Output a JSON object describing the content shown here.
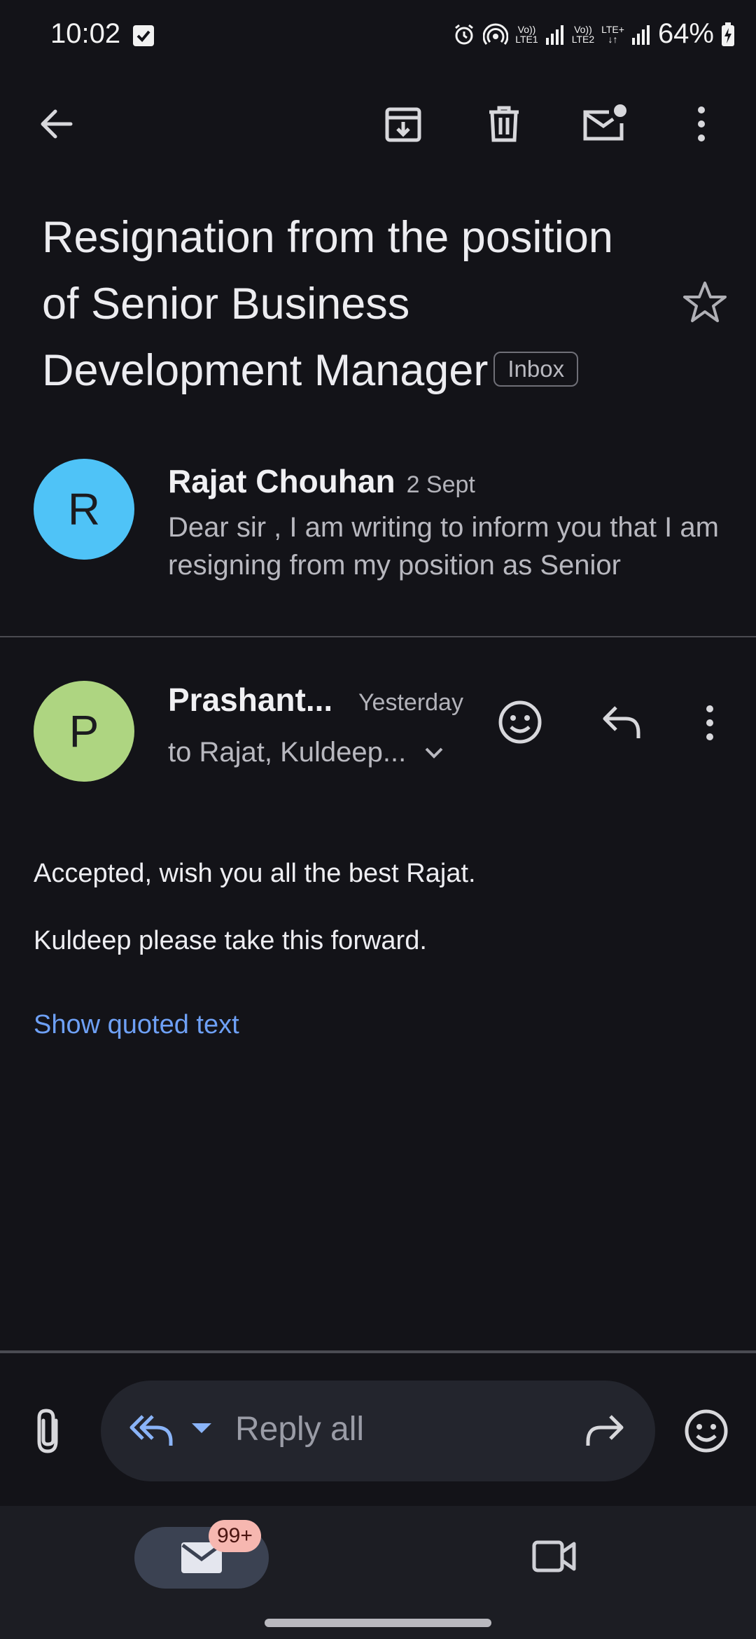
{
  "status_bar": {
    "time": "10:02",
    "sim1_top": "Vo))",
    "sim1_bottom": "LTE1",
    "sim2_top": "Vo))",
    "sim2_bottom": "LTE2",
    "sim2_extra": "LTE+",
    "battery": "64%"
  },
  "toolbar": {
    "icons": [
      "back-arrow-icon",
      "archive-icon",
      "delete-icon",
      "mark-unread-icon",
      "more-vert-icon"
    ]
  },
  "email": {
    "subject": "Resignation from the position of Senior Business Development Manager",
    "label": "Inbox",
    "starred": false
  },
  "messages": [
    {
      "avatar_letter": "R",
      "avatar_color": "#4fc3f7",
      "sender": "Rajat Chouhan",
      "date": "2 Sept",
      "snippet": "Dear sir , I am writing to inform you that I am resigning from my position as Senior"
    },
    {
      "avatar_letter": "P",
      "avatar_color": "#aed581",
      "sender": "Prashant...",
      "date": "Yesterday",
      "recipients": "to Rajat, Kuldeep...",
      "body_lines": [
        "Accepted, wish you all the best Rajat.",
        "Kuldeep please take this forward."
      ],
      "show_quoted": "Show quoted text"
    }
  ],
  "reply_bar": {
    "placeholder": "Reply all"
  },
  "bottom_nav": {
    "mail_badge": "99+"
  },
  "colors": {
    "background": "#131318",
    "link": "#6ea0f5",
    "reply_accent": "#8ab4f8"
  }
}
